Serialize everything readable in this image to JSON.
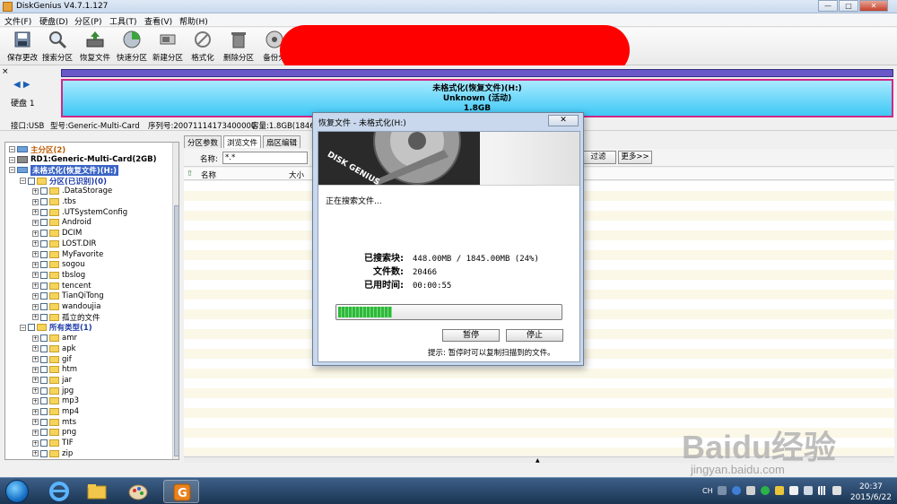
{
  "window": {
    "title": "DiskGenius V4.7.1.127",
    "buttons": {
      "minimize": "—",
      "maximize": "□",
      "close": "✕"
    }
  },
  "menu": [
    "文件(F)",
    "硬盘(D)",
    "分区(P)",
    "工具(T)",
    "查看(V)",
    "帮助(H)"
  ],
  "toolbar": [
    {
      "label": "保存更改",
      "icon": "save-icon"
    },
    {
      "label": "搜索分区",
      "icon": "magnifier-icon"
    },
    {
      "label": "恢复文件",
      "icon": "recover-icon"
    },
    {
      "label": "快速分区",
      "icon": "quick-partition-icon"
    },
    {
      "label": "新建分区",
      "icon": "new-partition-icon"
    },
    {
      "label": "格式化",
      "icon": "format-icon"
    },
    {
      "label": "删除分区",
      "icon": "trash-icon"
    },
    {
      "label": "备份分",
      "icon": "backup-icon"
    }
  ],
  "disk": {
    "close_mark": "×",
    "nav": "◀ ▶",
    "label": "硬盘 1",
    "partition_line1": "未格式化(恢复文件)(H:)",
    "partition_line2": "Unknown (活动)",
    "partition_line3": "1.8GB",
    "info": {
      "interface": "接口:USB",
      "model": "型号:Generic-Multi-Card",
      "serial": "序列号:20071114173400000",
      "capacity": "容量:1.8GB(1846M"
    }
  },
  "tree": [
    {
      "text": "主分区(2)",
      "level": 1,
      "type": "partition",
      "style": "orange"
    },
    {
      "text": "RD1:Generic-Multi-Card(2GB)",
      "level": 0,
      "type": "disk",
      "style": "bold"
    },
    {
      "text": "未格式化(恢复文件)(H:)",
      "level": 1,
      "type": "partition",
      "style": "selected"
    },
    {
      "text": "分区(已识别)(0)",
      "level": 2,
      "type": "folder",
      "style": "blue"
    },
    {
      "text": ".DataStorage",
      "level": 3,
      "type": "folder"
    },
    {
      "text": ".tbs",
      "level": 3,
      "type": "folder"
    },
    {
      "text": ".UTSystemConfig",
      "level": 3,
      "type": "folder"
    },
    {
      "text": "Android",
      "level": 3,
      "type": "folder"
    },
    {
      "text": "DCIM",
      "level": 3,
      "type": "folder"
    },
    {
      "text": "LOST.DIR",
      "level": 3,
      "type": "folder"
    },
    {
      "text": "MyFavorite",
      "level": 3,
      "type": "folder"
    },
    {
      "text": "sogou",
      "level": 3,
      "type": "folder"
    },
    {
      "text": "tbslog",
      "level": 3,
      "type": "folder"
    },
    {
      "text": "tencent",
      "level": 3,
      "type": "folder"
    },
    {
      "text": "TianQiTong",
      "level": 3,
      "type": "folder"
    },
    {
      "text": "wandoujia",
      "level": 3,
      "type": "folder"
    },
    {
      "text": "孤立的文件",
      "level": 3,
      "type": "folder"
    },
    {
      "text": "所有类型(1)",
      "level": 2,
      "type": "folder",
      "style": "blue"
    },
    {
      "text": "amr",
      "level": 3,
      "type": "folder"
    },
    {
      "text": "apk",
      "level": 3,
      "type": "folder"
    },
    {
      "text": "gif",
      "level": 3,
      "type": "folder"
    },
    {
      "text": "htm",
      "level": 3,
      "type": "folder"
    },
    {
      "text": "jar",
      "level": 3,
      "type": "folder"
    },
    {
      "text": "jpg",
      "level": 3,
      "type": "folder"
    },
    {
      "text": "mp3",
      "level": 3,
      "type": "folder"
    },
    {
      "text": "mp4",
      "level": 3,
      "type": "folder"
    },
    {
      "text": "mts",
      "level": 3,
      "type": "folder"
    },
    {
      "text": "png",
      "level": 3,
      "type": "folder"
    },
    {
      "text": "TIF",
      "level": 3,
      "type": "folder"
    },
    {
      "text": "zip",
      "level": 3,
      "type": "folder"
    }
  ],
  "tabs": [
    "分区参数",
    "浏览文件",
    "扇区编辑"
  ],
  "filter": {
    "name_label": "名称:",
    "name_value": "*.*",
    "filter_button": "过滤",
    "more_button": "更多>>"
  },
  "columns": [
    "名称",
    "大小"
  ],
  "dialog": {
    "title": "恢复文件 - 未格式化(H:)",
    "close": "✕",
    "status": "正在搜索文件...",
    "searched_label": "已搜索块:",
    "searched_value": "448.00MB / 1845.00MB (24%)",
    "files_label": "文件数:",
    "files_value": "20466",
    "elapsed_label": "已用时间:",
    "elapsed_value": "00:00:55",
    "progress_percent": 24,
    "pause_button": "暂停",
    "stop_button": "停止",
    "hint": "提示: 暂停时可以复制扫描到的文件。",
    "logo_text": "DISK GENIUS"
  },
  "watermark": {
    "brand": "Baidu经验",
    "url": "jingyan.baidu.com"
  },
  "taskbar": {
    "lang": "CH",
    "time": "20:37",
    "date": "2015/6/22"
  }
}
